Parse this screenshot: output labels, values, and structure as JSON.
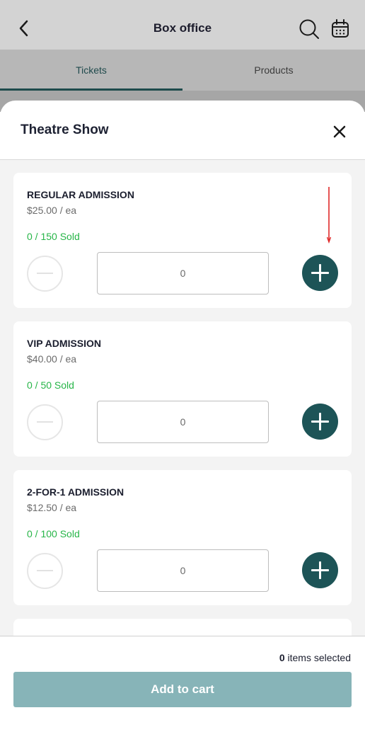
{
  "header": {
    "title": "Box office"
  },
  "tabs": [
    {
      "label": "Tickets",
      "active": true
    },
    {
      "label": "Products",
      "active": false
    }
  ],
  "sheet": {
    "title": "Theatre Show"
  },
  "tickets": [
    {
      "name": "REGULAR ADMISSION",
      "price": "$25.00 / ea",
      "sold": "0 / 150  Sold",
      "quantity": "0"
    },
    {
      "name": "VIP ADMISSION",
      "price": "$40.00 / ea",
      "sold": "0 / 50  Sold",
      "quantity": "0"
    },
    {
      "name": "2-FOR-1 ADMISSION",
      "price": "$12.50 / ea",
      "sold": "0 / 100  Sold",
      "quantity": "0"
    }
  ],
  "footer": {
    "selected_count": "0",
    "selected_label": "items selected",
    "add_to_cart": "Add to cart"
  },
  "icons": {
    "back": "chevron-left-icon",
    "search": "search-icon",
    "calendar": "calendar-icon",
    "close": "close-icon",
    "minus": "minus-icon",
    "plus": "plus-icon"
  },
  "colors": {
    "accent": "#1d5457",
    "sold": "#27b548",
    "button_disabled": "#87b4b8",
    "annotation_arrow": "#e02a2a"
  }
}
